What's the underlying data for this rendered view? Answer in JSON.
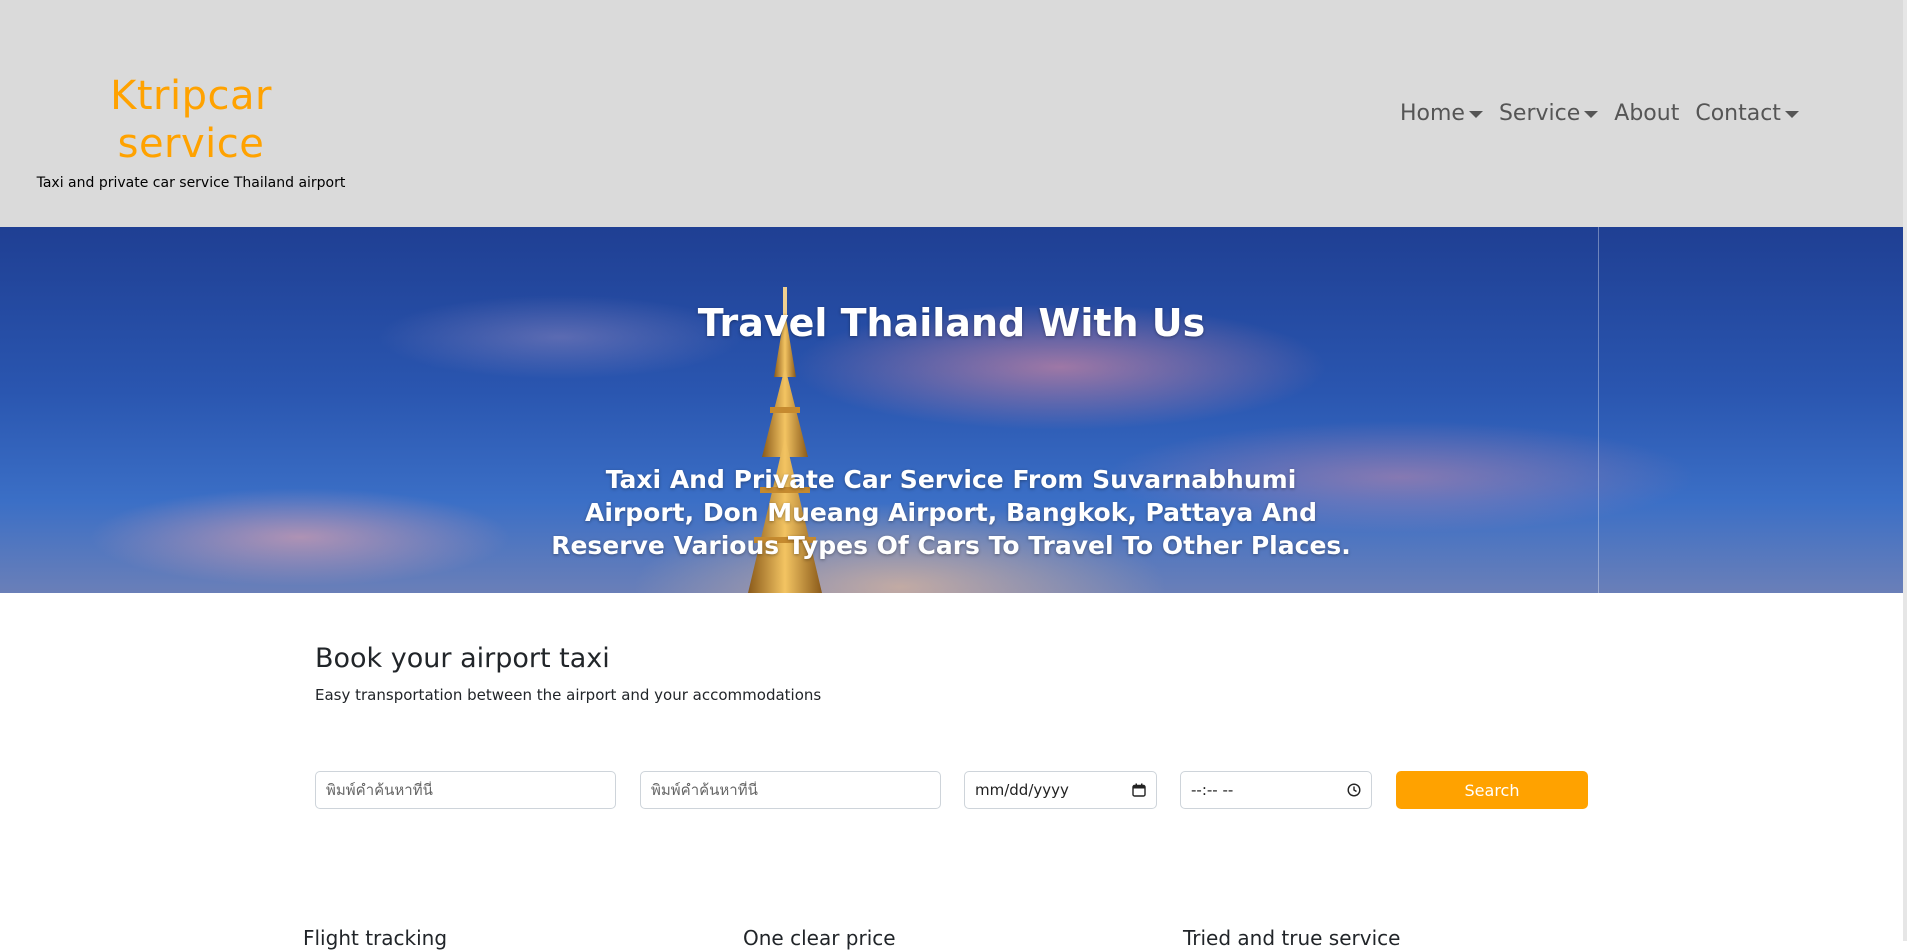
{
  "header": {
    "brand_title": "Ktripcar service",
    "brand_subtitle": "Taxi and private car service Thailand airport",
    "nav": [
      {
        "label": "Home",
        "dropdown": true
      },
      {
        "label": "Service",
        "dropdown": true
      },
      {
        "label": "About",
        "dropdown": false
      },
      {
        "label": "Contact",
        "dropdown": true
      }
    ]
  },
  "hero": {
    "title": "Travel Thailand With Us",
    "subtitle": "Taxi And Private Car Service From Suvarnabhumi Airport, Don Mueang Airport, Bangkok, Pattaya And Reserve Various Types Of Cars To Travel To Other Places."
  },
  "booking": {
    "title": "Book your airport taxi",
    "subtitle": "Easy transportation between the airport and your accommodations",
    "from_placeholder": "พิมพ์คำค้นหาที่นี่",
    "to_placeholder": "พิมพ์คำค้นหาที่นี่",
    "date_value": "mm/dd/yyyy",
    "time_value": "--:-- --",
    "search_label": "Search"
  },
  "features": [
    {
      "title": "Flight tracking"
    },
    {
      "title": "One clear price"
    },
    {
      "title": "Tried and true service"
    }
  ],
  "colors": {
    "brand": "#ffa200",
    "header_bg": "#dadada",
    "hero_sky": "#2a56b0"
  }
}
